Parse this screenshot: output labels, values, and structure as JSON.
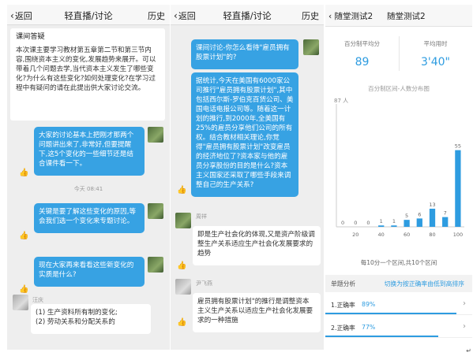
{
  "panel1": {
    "header": {
      "back": "返回",
      "title": "轻直播/讨论",
      "history": "历史"
    },
    "intro": {
      "title": "课间答疑",
      "body": "本次课主要学习教材第五章第二节和第三节内容,围绕资本主义的变化,发展趋势来展开。可以带着几个问题去学,当代资本主义发生了哪些变化?为什么有这些变化?如何处理变化?在学习过程中有疑问的请在此提出供大家讨论交流。"
    },
    "bubble1": "大家的讨论基本上把刚才那两个问题讲出来了,非常好,但要提醒下,这5个变化的一些细节还是结合课件看一下。",
    "time": "今天 08:41",
    "bubble2": "关键是要了解这些变化的原因,等会我们选一个变化来专题讨论。",
    "bubble3": "现在大家再来看看这些新变化的实质是什么?",
    "reply": {
      "name": "汪庆",
      "line1": "(1) 生产资料所有制的变化;",
      "line2": "(2) 劳动关系和分配关系的"
    }
  },
  "panel2": {
    "header": {
      "back": "返回",
      "title": "轻直播/讨论",
      "history": "历史"
    },
    "bubble1": "课间讨论-你怎么看待\"雇员拥有股票计划\"的?",
    "bubble2": "据统计,今天在美国有6000家公司推行\"雇员拥有股票计划\",其中包括西尔斯-罗伯克百货公司、美国电话电报公司等。随着这一计划的推行,到2000年,全美国有25%的雇员分享他们公司的所有权。结合教材相关理论,你觉得\"雇员拥有股票计划\"改变雇员的经济地位了?资本家与他的雇员分享股份的目的是什么?资本主义国家还采取了哪些手段来调整自己的生产关系?",
    "reply1": {
      "name": "周祥",
      "text": "即是生产社会化的体现,又是资产阶级调整生产关系适应生产社会化发展要求的趋势"
    },
    "reply2": {
      "name": "尹飞燕",
      "text": "雇员拥有股票计划\"的推行是调整资本主义生产关系以适应生产社会化发展要求的一种措施"
    }
  },
  "panel3": {
    "header": {
      "back": "随堂测试2",
      "title": "随堂测试2"
    },
    "stats": {
      "avg_score_label": "百分制平均分",
      "avg_score": "89",
      "avg_time_label": "平均用时",
      "avg_time": "3'40\""
    },
    "chart_title": "百分制区间-人数分布图",
    "note": "每10分一个区间,共10个区间",
    "section": {
      "label": "单题分析",
      "action": "切换为按正确率由低到高排序"
    },
    "questions": [
      {
        "label": "1.正确率",
        "rate": "89%",
        "fraction": 0.89
      },
      {
        "label": "2.正确率",
        "rate": "77%",
        "fraction": 0.77
      }
    ]
  },
  "chart_data": {
    "type": "bar",
    "title": "百分制区间-人数分布图",
    "ylabel": "87 人",
    "xlabel": "",
    "x_ticks": [
      "20",
      "40",
      "60",
      "80",
      "100"
    ],
    "values": [
      0,
      0,
      0,
      1,
      1,
      5,
      6,
      13,
      7,
      55
    ],
    "ylim": [
      0,
      87
    ],
    "color": "#2e9ce0"
  },
  "colors": {
    "accent": "#37a2e3",
    "bar": "#2e9ce0"
  },
  "icons": {
    "back": "chevron-left-icon",
    "like": "thumb-up-icon",
    "more": "chevron-right-icon"
  },
  "corner_mark": "↵"
}
